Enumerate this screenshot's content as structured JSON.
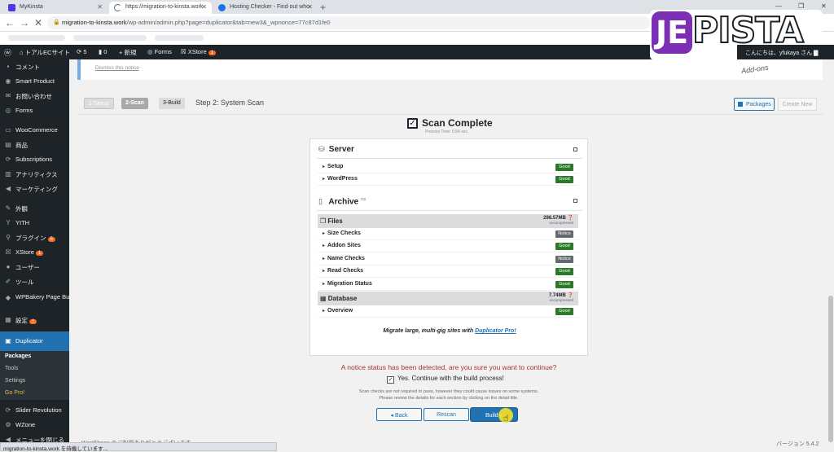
{
  "browser": {
    "tabs": [
      {
        "label": "MyKinsta",
        "active": false
      },
      {
        "label": "https://migration-to-kinsta.work",
        "active": true
      },
      {
        "label": "Hosting Checker - Find out who",
        "active": false
      }
    ],
    "new_tab": "+",
    "url_host": "migration-to-kinsta.work",
    "url_path": "/wp-admin/admin.php?page=duplicator&tab=new3&_wpnonce=77c87d1fe0",
    "status_text": "migration-to-kinsta.work を待機しています..."
  },
  "watermark": {
    "mark": "JE",
    "word": "PISTA"
  },
  "adminbar": {
    "site_name": "トアルECサイト",
    "updates": "5",
    "comments": "0",
    "new_label": "新規",
    "forms_label": "Forms",
    "xstore_label": "XStore",
    "xstore_badge": "1",
    "greeting": "こんにちは、yfukaya さん"
  },
  "sidebar": {
    "items": [
      {
        "label": "コメント",
        "icon": "comment-icon"
      },
      {
        "label": "Smart Product",
        "icon": "eye-icon"
      },
      {
        "label": "お問い合わせ",
        "icon": "mail-icon"
      },
      {
        "label": "Forms",
        "icon": "forms-icon"
      },
      {
        "label": "WooCommerce",
        "icon": "woo-icon"
      },
      {
        "label": "商品",
        "icon": "product-icon"
      },
      {
        "label": "Subscriptions",
        "icon": "subscriptions-icon"
      },
      {
        "label": "アナリティクス",
        "icon": "analytics-icon"
      },
      {
        "label": "マーケティング",
        "icon": "megaphone-icon"
      },
      {
        "label": "外観",
        "icon": "brush-icon"
      },
      {
        "label": "YITH",
        "icon": "yith-icon"
      },
      {
        "label": "プラグイン",
        "icon": "plugin-icon",
        "badge": "5"
      },
      {
        "label": "XStore",
        "icon": "xstore-icon",
        "badge": "1"
      },
      {
        "label": "ユーザー",
        "icon": "user-icon"
      },
      {
        "label": "ツール",
        "icon": "wrench-icon"
      },
      {
        "label": "WPBakery Page Builder",
        "icon": "wpbakery-icon"
      },
      {
        "label": "設定",
        "icon": "settings-icon",
        "badge": "1"
      },
      {
        "label": "Duplicator",
        "icon": "duplicator-icon"
      },
      {
        "label": "Slider Revolution",
        "icon": "slider-icon"
      },
      {
        "label": "WZone",
        "icon": "wzone-icon"
      },
      {
        "label": "メニューを閉じる",
        "icon": "collapse-icon"
      }
    ],
    "submenu": [
      "Packages",
      "Tools",
      "Settings",
      "Go Pro!"
    ]
  },
  "notice": {
    "dismiss": "Dismiss this notice",
    "addons": "Add-ons"
  },
  "steps": {
    "s1": "1-Setup",
    "s2": "2-Scan",
    "s3": "3-Build",
    "title": "Step 2: System Scan"
  },
  "toolbar": {
    "packages": "Packages",
    "create_new": "Create New"
  },
  "scan": {
    "title": "Scan Complete",
    "process_time": "Process Time: 0.54 sec."
  },
  "server": {
    "title": "Server",
    "rows": [
      {
        "label": "Setup",
        "status": "Good"
      },
      {
        "label": "WordPress",
        "status": "Good"
      }
    ]
  },
  "archive": {
    "title": "Archive",
    "sup": "zip",
    "files": {
      "label": "Files",
      "size": "298.57MB",
      "sub": "uncompressed"
    },
    "file_rows": [
      {
        "label": "Size Checks",
        "status": "Notice"
      },
      {
        "label": "Addon Sites",
        "status": "Good"
      },
      {
        "label": "Name Checks",
        "status": "Notice"
      },
      {
        "label": "Read Checks",
        "status": "Good"
      },
      {
        "label": "Migration Status",
        "status": "Good"
      }
    ],
    "database": {
      "label": "Database",
      "size": "7.74MB",
      "sub": "uncompressed"
    },
    "db_rows": [
      {
        "label": "Overview",
        "status": "Good"
      }
    ]
  },
  "promo": {
    "text": "Migrate large, multi-gig sites with ",
    "link": "Duplicator Pro!"
  },
  "confirm": {
    "question": "A notice status has been detected, are you sure you want to continue?",
    "checkbox_label": "Yes. Continue with the build process!",
    "fine1": "Scan checks are not required to pass, however they could cause issues on some systems.",
    "fine2": "Please review the details for each section by clicking on the detail title."
  },
  "buttons": {
    "back": "◂ Back",
    "rescan": "Rescan",
    "build": "Build ▸"
  },
  "footer": {
    "thanks": "WordPress のご利用ありがとうございます。",
    "version": "バージョン 5.4.2"
  },
  "colors": {
    "accent": "#2271b1",
    "good": "#2b7a2b",
    "notice": "#646970",
    "warning_text": "#a83232"
  }
}
